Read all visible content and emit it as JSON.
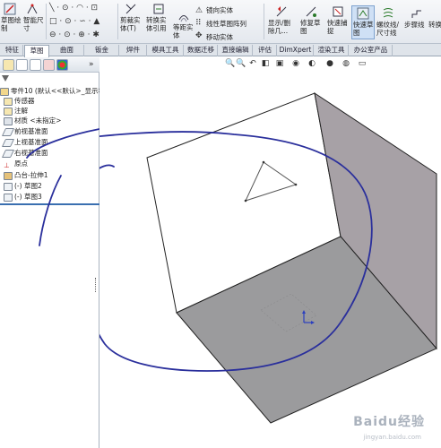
{
  "ribbon": {
    "items": [
      {
        "label": "草图绘\n制"
      },
      {
        "label": "智能尺\n寸"
      },
      {
        "label": "剪裁实\n体(T)"
      },
      {
        "label": "转换实\n体引用"
      },
      {
        "label": "等距实\n体"
      },
      {
        "label": "镜向实体"
      },
      {
        "label": "线性草图阵列"
      },
      {
        "label": "移动实体"
      },
      {
        "label": "显示/删\n除几..."
      },
      {
        "label": "修复草\n图"
      },
      {
        "label": "快速捕\n捉"
      },
      {
        "label": "快速草\n图"
      },
      {
        "label": "螺纹线/\n尺寸线"
      },
      {
        "label": "步骤线"
      },
      {
        "label": "转换"
      }
    ]
  },
  "tabs": [
    "特征",
    "草图",
    "曲面",
    "钣金",
    "焊件",
    "模具工具",
    "数据迁移",
    "直接编辑",
    "评估",
    "DimXpert",
    "渲染工具",
    "办公室产品"
  ],
  "active_tab": 1,
  "tree": {
    "root": "零件10 (默认<<默认>_显示状",
    "items": [
      "传感器",
      "注解",
      "材质 <未指定>",
      "前视基准面",
      "上视基准面",
      "右视基准面",
      "原点",
      "凸台-拉伸1",
      "(-) 草图2",
      "(-) 草图3"
    ]
  },
  "watermark": {
    "main": "Baidu经验",
    "sub": "jingyan.baidu.com"
  },
  "colors": {
    "sketch_line": "#2a2f9c",
    "cube_right": "#a7a1a6",
    "cube_bottom": "#9b9b9d",
    "accent": "#3a6fb0"
  }
}
